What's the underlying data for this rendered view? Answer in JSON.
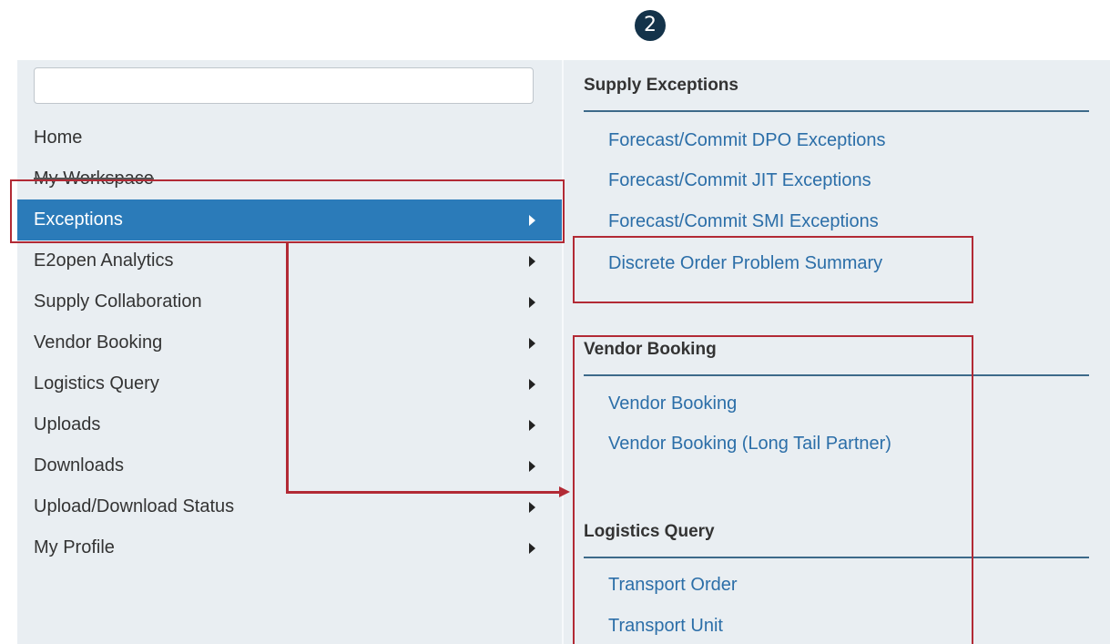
{
  "step_badge": "2",
  "search": {
    "value": "",
    "placeholder": ""
  },
  "nav": [
    {
      "label": "Home",
      "has_submenu": false,
      "active": false
    },
    {
      "label": "My Workspace",
      "has_submenu": false,
      "active": false
    },
    {
      "label": "Exceptions",
      "has_submenu": true,
      "active": true
    },
    {
      "label": "E2open Analytics",
      "has_submenu": true,
      "active": false
    },
    {
      "label": "Supply Collaboration",
      "has_submenu": true,
      "active": false
    },
    {
      "label": "Vendor Booking",
      "has_submenu": true,
      "active": false
    },
    {
      "label": "Logistics Query",
      "has_submenu": true,
      "active": false
    },
    {
      "label": "Uploads",
      "has_submenu": true,
      "active": false
    },
    {
      "label": "Downloads",
      "has_submenu": true,
      "active": false
    },
    {
      "label": "Upload/Download Status",
      "has_submenu": true,
      "active": false
    },
    {
      "label": "My Profile",
      "has_submenu": true,
      "active": false
    }
  ],
  "submenu": {
    "supply_exceptions": {
      "title": "Supply Exceptions",
      "links": [
        "Forecast/Commit DPO Exceptions",
        "Forecast/Commit JIT Exceptions",
        "Forecast/Commit SMI Exceptions",
        "Discrete Order Problem Summary"
      ]
    },
    "vendor_booking": {
      "title": "Vendor Booking",
      "links": [
        "Vendor Booking",
        "Vendor Booking (Long Tail Partner)"
      ]
    },
    "logistics_query": {
      "title": "Logistics Query",
      "links": [
        "Transport Order",
        "Transport Unit"
      ]
    }
  },
  "colors": {
    "active_nav_bg": "#2b7bb9",
    "link": "#2b6ea8",
    "highlight": "#b22a35",
    "badge_bg": "#14334a",
    "panel_bg": "#e9eef2"
  }
}
